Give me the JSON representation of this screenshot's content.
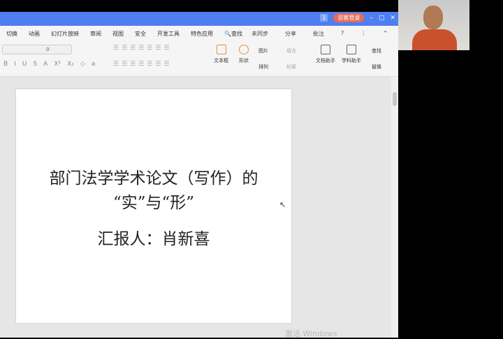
{
  "titlebar": {
    "badge": "1",
    "login": "访客登录",
    "min": "–",
    "max": "▢",
    "close": "✕"
  },
  "menu": {
    "items": [
      "切换",
      "动画",
      "幻灯片放映",
      "审阅",
      "视图",
      "安全",
      "开发工具",
      "特色应用",
      "查找"
    ],
    "right": [
      "未同步",
      "分享",
      "批注",
      "?",
      "⋮",
      "^"
    ]
  },
  "toolbar": {
    "font_size": "0",
    "format": [
      "B",
      "I",
      "U",
      "S",
      "A",
      "X²",
      "X₂",
      "◇",
      "a"
    ],
    "tools": [
      "文本框",
      "形状",
      "图片",
      "排列",
      "填充",
      "轮廓",
      "文档助手",
      "学科助手",
      "查找",
      "替换"
    ]
  },
  "slide": {
    "title_line1": "部门法学学术论文（写作）的",
    "title_line2": "“实”与“形”",
    "presenter": "汇报人：肖新喜"
  },
  "watermark": "激活 Windows"
}
